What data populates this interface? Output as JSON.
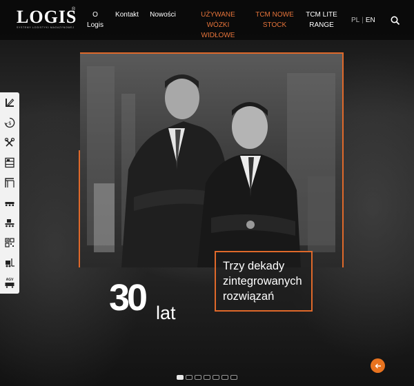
{
  "brand": {
    "logo_text": "LOGIS",
    "registered": "®",
    "tagline": "SYSTEMY LOGISTYKI MAGAZYNOWEJ"
  },
  "nav": {
    "items": [
      {
        "label": "O\nLogis",
        "accent": false
      },
      {
        "label": "Kontakt",
        "accent": false
      },
      {
        "label": "Nowości",
        "accent": false
      },
      {
        "label": "UŻYWANE WÓZKI\nWIDŁOWE",
        "accent": true
      },
      {
        "label": "TCM NOWE\nSTOCK",
        "accent": true
      },
      {
        "label": "TCM LITE\nRANGE",
        "accent": false
      }
    ],
    "lang": {
      "pl": "PL",
      "sep": "|",
      "en": "EN"
    },
    "search_icon": "search-icon"
  },
  "sidebar": {
    "items": [
      {
        "icon": "pencil-ruler-icon"
      },
      {
        "icon": "clock-coin-icon"
      },
      {
        "icon": "tools-icon"
      },
      {
        "icon": "shelving-icon"
      },
      {
        "icon": "rack-icon"
      },
      {
        "icon": "pallet-icon"
      },
      {
        "icon": "conveyor-icon"
      },
      {
        "icon": "qr-code-icon"
      },
      {
        "icon": "forklift-icon"
      },
      {
        "icon": "agv-icon"
      }
    ],
    "agv_label": "AGV"
  },
  "slide": {
    "tagline_lines": [
      "Trzy dekady",
      "zintegrowanych",
      "rozwiązań"
    ],
    "big_number": "30",
    "big_suffix": "lat"
  },
  "slider": {
    "dot_count": 7,
    "active_index": 0,
    "back_icon": "arrow-left-icon"
  },
  "colors": {
    "accent": "#e0692a",
    "button": "#e8731f",
    "header_bg": "#0a0a0a"
  }
}
